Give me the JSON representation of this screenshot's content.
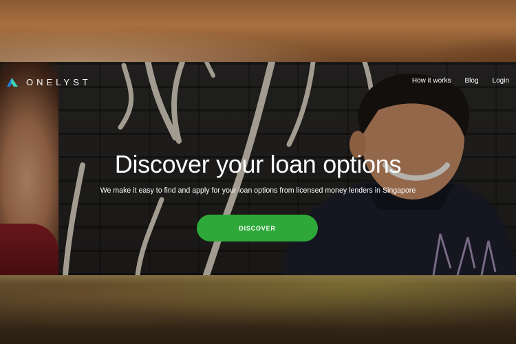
{
  "brand": {
    "name": "ONELYST",
    "logo_icon": "onelyst-logo-icon",
    "logo_colors": [
      "#1e7fd8",
      "#3fd0b0"
    ]
  },
  "nav": {
    "items": [
      {
        "label": "How it works"
      },
      {
        "label": "Blog"
      },
      {
        "label": "Login"
      }
    ]
  },
  "hero": {
    "title": "Discover your loan options",
    "subtitle": "We make it easy to find and apply for your loan options from licensed money lenders in Singapore",
    "cta_label": "DISCOVER",
    "cta_color": "#2fa83a"
  }
}
